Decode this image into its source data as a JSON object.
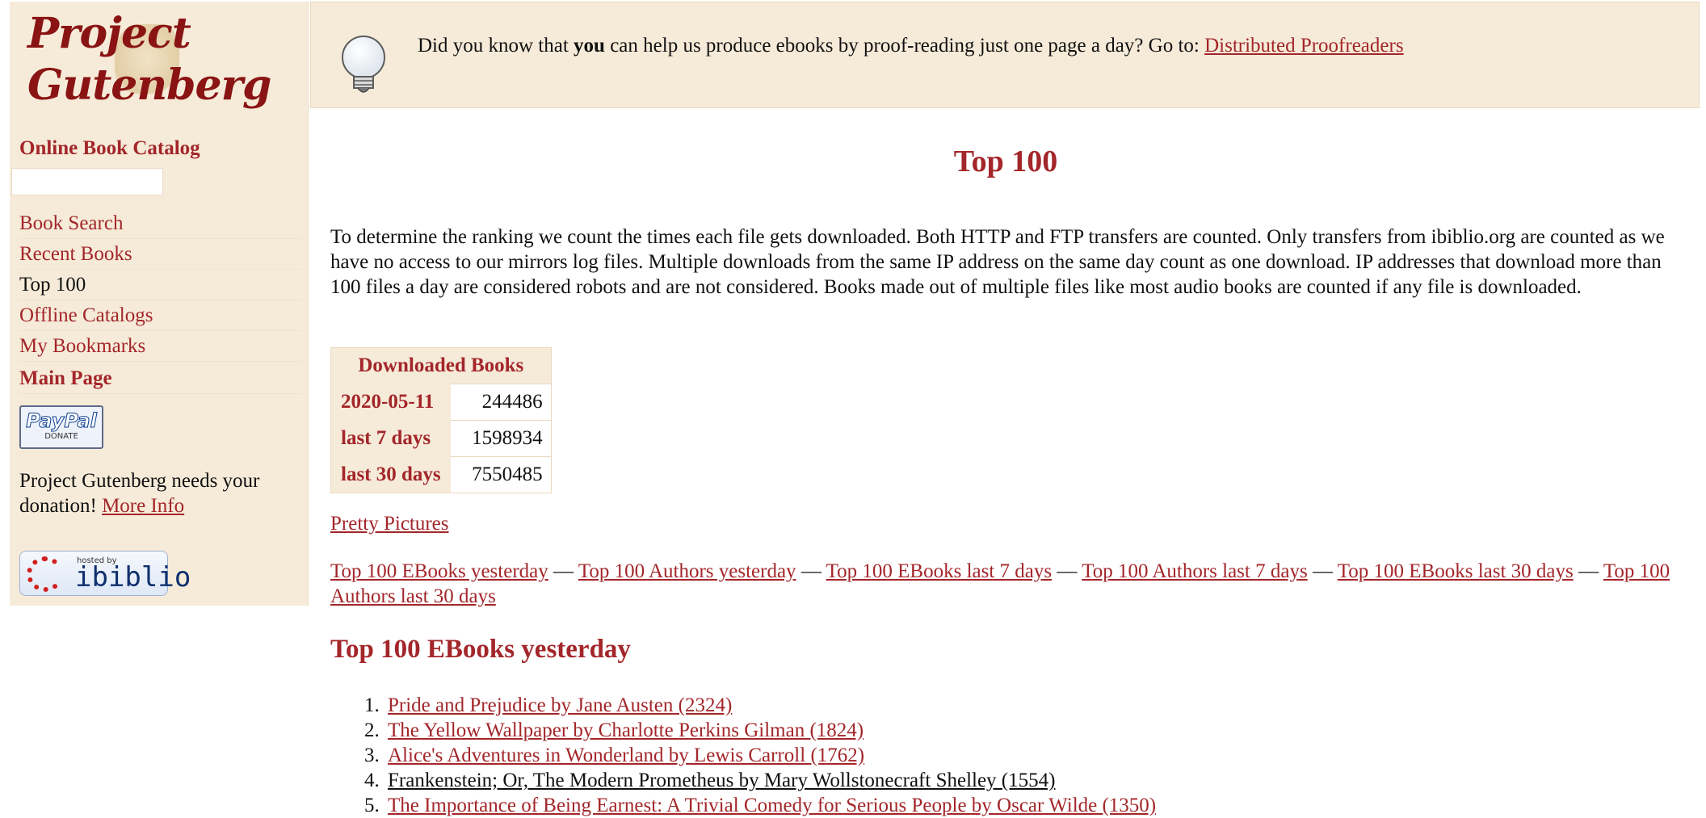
{
  "sidebar": {
    "logo_line1": "Project",
    "logo_line2": "Gutenberg",
    "catalog_heading": "Online Book Catalog",
    "search_value": "",
    "nav": [
      {
        "label": "Book Search"
      },
      {
        "label": "Recent Books"
      },
      {
        "label": "Top 100"
      },
      {
        "label": "Offline Catalogs"
      },
      {
        "label": "My Bookmarks"
      },
      {
        "label": "Main Page"
      }
    ],
    "paypal_word": "PayPal",
    "paypal_donate": "DONATE",
    "donation_text": "Project Gutenberg needs your donation!",
    "donation_link": "More Info",
    "ibiblio_hosted": "hosted by",
    "ibiblio_word": "ibiblio"
  },
  "banner": {
    "text_pre": "Did you know that ",
    "text_bold": "you",
    "text_post": " can help us produce ebooks by proof-reading just one page a day? Go to: ",
    "link": "Distributed Proofreaders"
  },
  "main": {
    "title": "Top 100",
    "intro": "To determine the ranking we count the times each file gets downloaded. Both HTTP and FTP transfers are counted. Only transfers from ibiblio.org are counted as we have no access to our mirrors log files. Multiple downloads from the same IP address on the same day count as one download. IP addresses that download more than 100 files a day are considered robots and are not considered. Books made out of multiple files like most audio books are counted if any file is downloaded.",
    "table": {
      "header": "Downloaded Books",
      "rows": [
        {
          "label": "2020-05-11",
          "value": "244486"
        },
        {
          "label": "last 7 days",
          "value": "1598934"
        },
        {
          "label": "last 30 days",
          "value": "7550485"
        }
      ]
    },
    "pretty_pictures": "Pretty Pictures",
    "top_links": [
      "Top 100 EBooks yesterday",
      "Top 100 Authors yesterday",
      "Top 100 EBooks last 7 days",
      "Top 100 Authors last 7 days",
      "Top 100 EBooks last 30 days",
      "Top 100 Authors last 30 days"
    ],
    "separator": "—",
    "list_heading": "Top 100 EBooks yesterday",
    "books": [
      "Pride and Prejudice by Jane Austen (2324)",
      "The Yellow Wallpaper by Charlotte Perkins Gilman (1824)",
      "Alice's Adventures in Wonderland by Lewis Carroll (1762)",
      "Frankenstein; Or, The Modern Prometheus by Mary Wollstonecraft Shelley (1554)",
      "The Importance of Being Earnest: A Trivial Comedy for Serious People by Oscar Wilde (1350)"
    ]
  },
  "icons": {
    "bulb": "lightbulb-icon"
  },
  "colors": {
    "accent": "#a3262a",
    "panel_bg": "#f6ebd9"
  }
}
